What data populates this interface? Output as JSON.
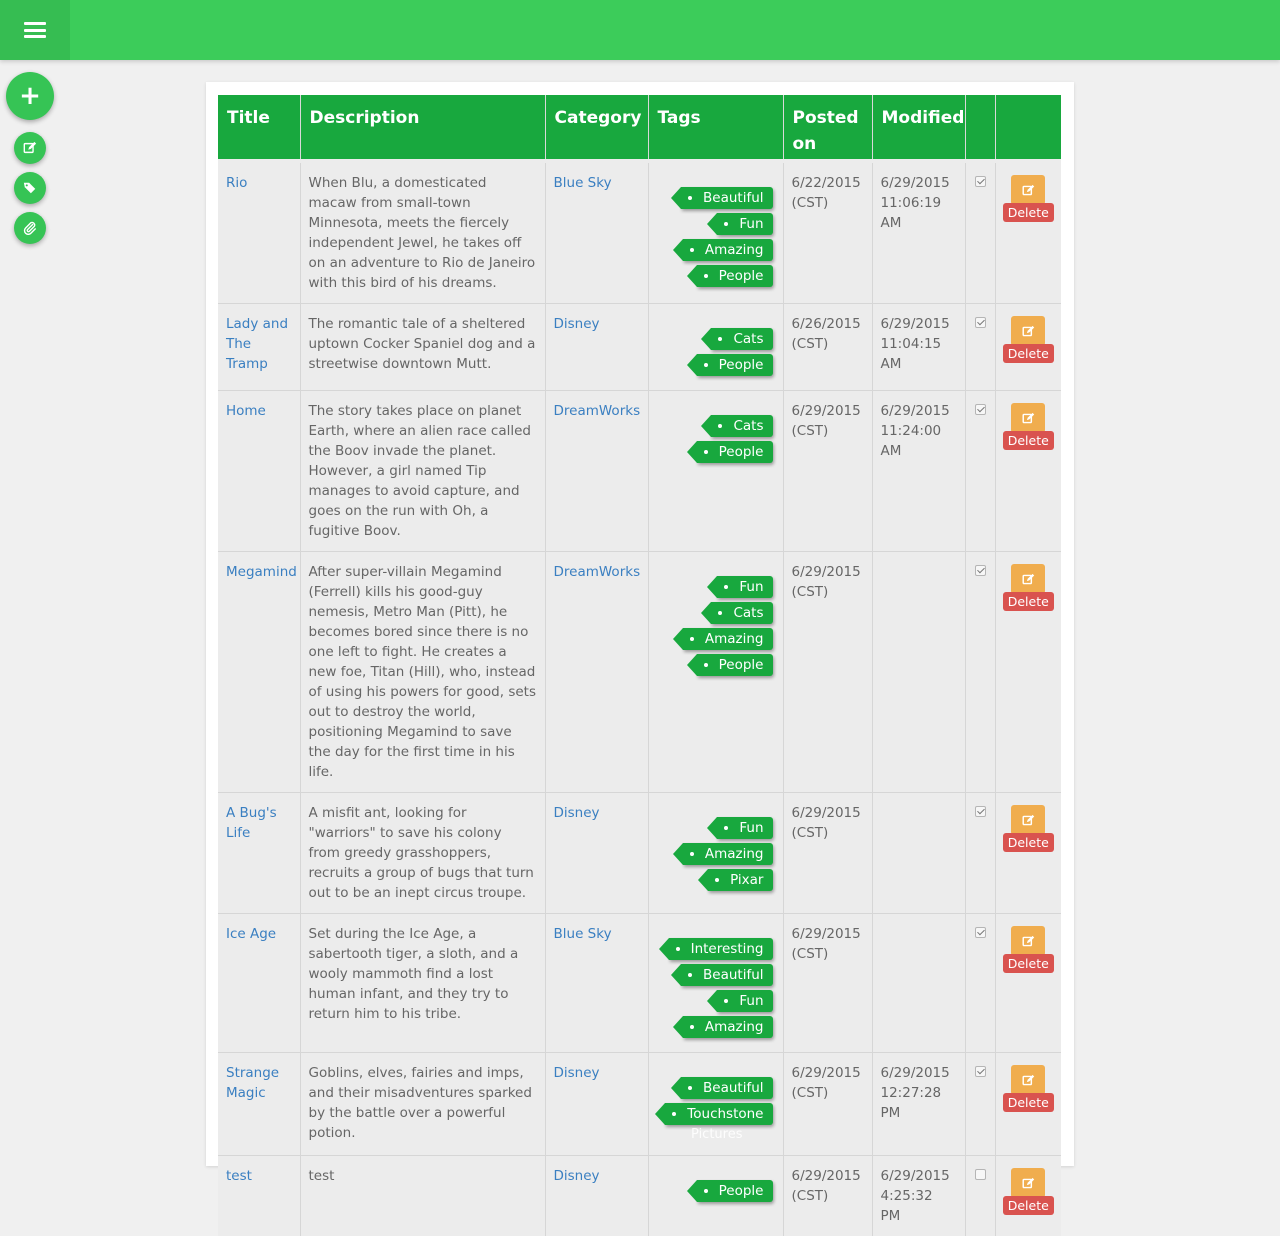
{
  "header": {
    "menu_icon": "hamburger-icon"
  },
  "sidebar_actions": [
    {
      "icon": "plus-icon"
    },
    {
      "icon": "edit-icon"
    },
    {
      "icon": "tags-icon"
    },
    {
      "icon": "paperclip-icon"
    }
  ],
  "table": {
    "columns": [
      "Title",
      "Description",
      "Category",
      "Tags",
      "Posted on",
      "Modified",
      "",
      ""
    ],
    "delete_label": "Delete",
    "rows": [
      {
        "title": "Rio",
        "description": "When Blu, a domesticated macaw from small-town Minnesota, meets the fiercely independent Jewel, he takes off on an adventure to Rio de Janeiro with this bird of his dreams.",
        "category": "Blue Sky",
        "tags": [
          "Beautiful",
          "Fun",
          "Amazing",
          "People"
        ],
        "posted": "6/22/2015 (CST)",
        "modified": "6/29/2015 11:06:19 AM",
        "checked": true
      },
      {
        "title": "Lady and The Tramp",
        "description": "The romantic tale of a sheltered uptown Cocker Spaniel dog and a streetwise downtown Mutt.",
        "category": "Disney",
        "tags": [
          "Cats",
          "People"
        ],
        "posted": "6/26/2015 (CST)",
        "modified": "6/29/2015 11:04:15 AM",
        "checked": true
      },
      {
        "title": "Home",
        "description": "The story takes place on planet Earth, where an alien race called the Boov invade the planet. However, a girl named Tip manages to avoid capture, and goes on the run with Oh, a fugitive Boov.",
        "category": "DreamWorks",
        "tags": [
          "Cats",
          "People"
        ],
        "posted": "6/29/2015 (CST)",
        "modified": "6/29/2015 11:24:00 AM",
        "checked": true
      },
      {
        "title": "Megamind",
        "description": "After super-villain Megamind (Ferrell) kills his good-guy nemesis, Metro Man (Pitt), he becomes bored since there is no one left to fight. He creates a new foe, Titan (Hill), who, instead of using his powers for good, sets out to destroy the world, positioning Megamind to save the day for the first time in his life.",
        "category": "DreamWorks",
        "tags": [
          "Fun",
          "Cats",
          "Amazing",
          "People"
        ],
        "posted": "6/29/2015 (CST)",
        "modified": "",
        "checked": true
      },
      {
        "title": "A Bug's Life",
        "description": "A misfit ant, looking for \"warriors\" to save his colony from greedy grasshoppers, recruits a group of bugs that turn out to be an inept circus troupe.",
        "category": "Disney",
        "tags": [
          "Fun",
          "Amazing",
          "Pixar"
        ],
        "posted": "6/29/2015 (CST)",
        "modified": "",
        "checked": true
      },
      {
        "title": "Ice Age",
        "description": "Set during the Ice Age, a sabertooth tiger, a sloth, and a wooly mammoth find a lost human infant, and they try to return him to his tribe.",
        "category": "Blue Sky",
        "tags": [
          "Interesting",
          "Beautiful",
          "Fun",
          "Amazing"
        ],
        "posted": "6/29/2015 (CST)",
        "modified": "",
        "checked": true
      },
      {
        "title": "Strange Magic",
        "description": "Goblins, elves, fairies and imps, and their misadventures sparked by the battle over a powerful potion.",
        "category": "Disney",
        "tags": [
          "Beautiful",
          "Touchstone"
        ],
        "tag_overflow": "Pictures",
        "posted": "6/29/2015 (CST)",
        "modified": "6/29/2015 12:27:28 PM",
        "checked": true
      },
      {
        "title": "test",
        "description": "test",
        "category": "Disney",
        "tags": [
          "People"
        ],
        "posted": "6/29/2015 (CST)",
        "modified": "6/29/2015 4:25:32 PM",
        "checked": false
      }
    ]
  }
}
